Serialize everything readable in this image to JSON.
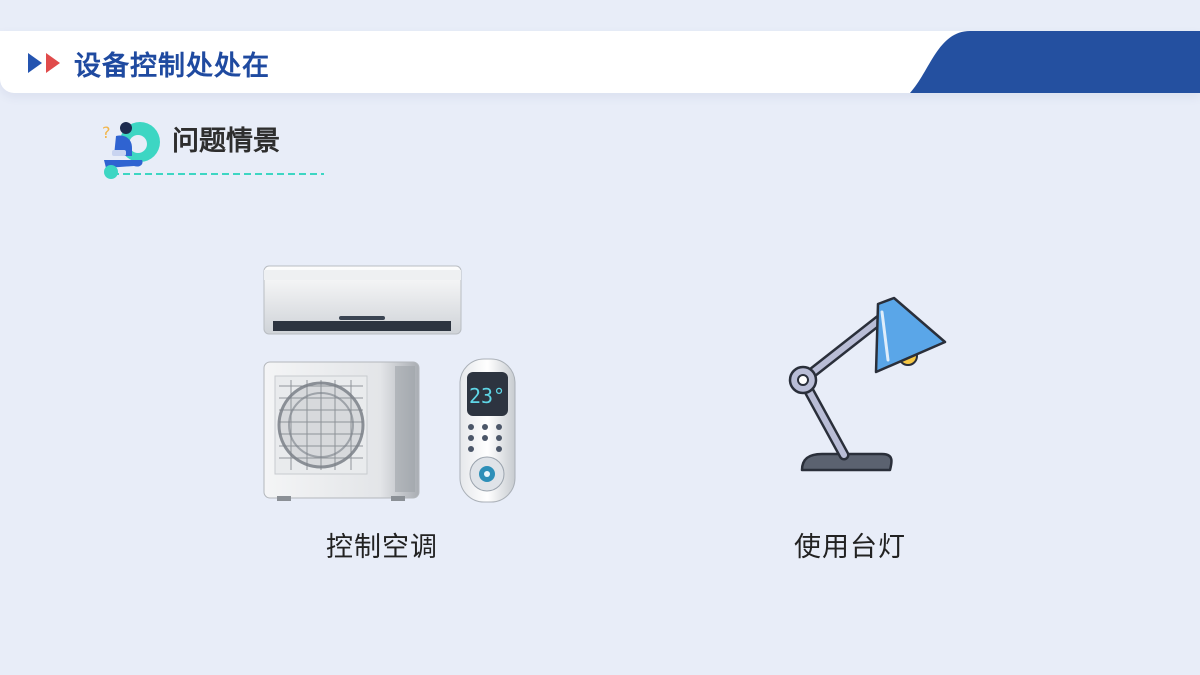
{
  "header": {
    "title": "设备控制处处在",
    "arrow_colors": [
      "#2454b0",
      "#e04b4b"
    ],
    "accent_color": "#2450a0"
  },
  "section": {
    "label": "问题情景",
    "icon": "person-thinking-icon",
    "line_color": "#3dd6c3"
  },
  "items": [
    {
      "icon": "air-conditioner-icon",
      "caption": "控制空调",
      "remote_display": "23°"
    },
    {
      "icon": "desk-lamp-icon",
      "caption": "使用台灯"
    }
  ]
}
